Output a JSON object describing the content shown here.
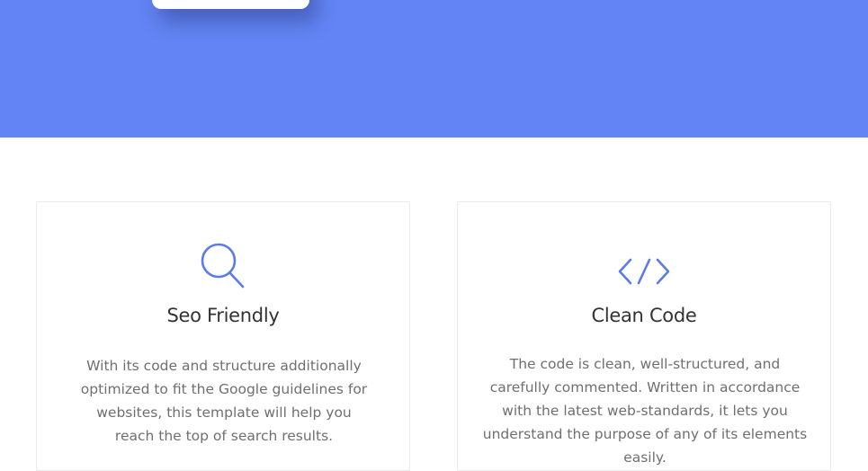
{
  "theme": {
    "hero_bg": "#6284f4",
    "accent": "#5b7bea",
    "title_color": "#333333",
    "text_color": "#6f6f6f"
  },
  "features": [
    {
      "icon": "search-icon",
      "title": "Seo Friendly",
      "description": "With its code and structure additionally optimized to fit the Google guidelines for websites, this template will help you reach the top of search results."
    },
    {
      "icon": "code-icon",
      "title": "Clean Code",
      "description": "The code is clean, well-structured, and carefully commented. Written in accordance with the latest web-standards, it lets you understand the purpose of any of its elements easily."
    }
  ]
}
